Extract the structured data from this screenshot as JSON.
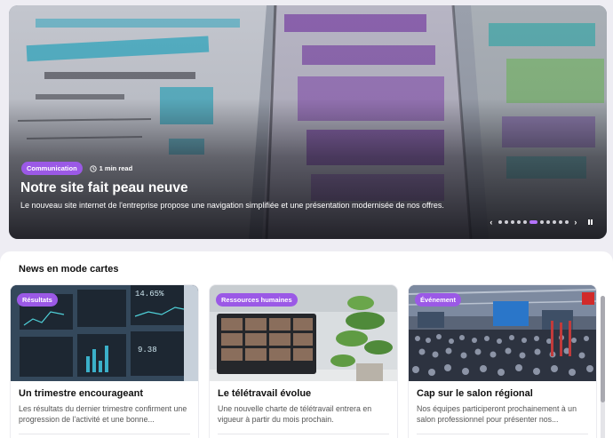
{
  "hero": {
    "category": "Communication",
    "read_time": "1 min read",
    "title": "Notre site fait peau neuve",
    "description": "Le nouveau site internet de l'entreprise propose une navigation simplifiée et une présentation modernisée de nos offres.",
    "prev_icon": "chevron-left-icon",
    "next_icon": "chevron-right-icon",
    "slide_count": 11,
    "active_slide": 6
  },
  "section": {
    "title": "News en mode cartes",
    "cards": [
      {
        "category": "Résultats",
        "title": "Un trimestre encourageant",
        "excerpt": "Les résultats du dernier trimestre confirment une progression de l'activité et une bonne..."
      },
      {
        "category": "Ressources humaines",
        "title": "Le télétravail évolue",
        "excerpt": "Une nouvelle charte de télétravail entrera en vigueur à partir du mois prochain."
      },
      {
        "category": "Événement",
        "title": "Cap sur le salon régional",
        "excerpt": "Nos équipes participeront prochainement à un salon professionnel pour présenter nos..."
      }
    ]
  },
  "colors": {
    "accent": "#9b59e6",
    "dot_active": "#b573ff",
    "background": "#eeedf3"
  }
}
